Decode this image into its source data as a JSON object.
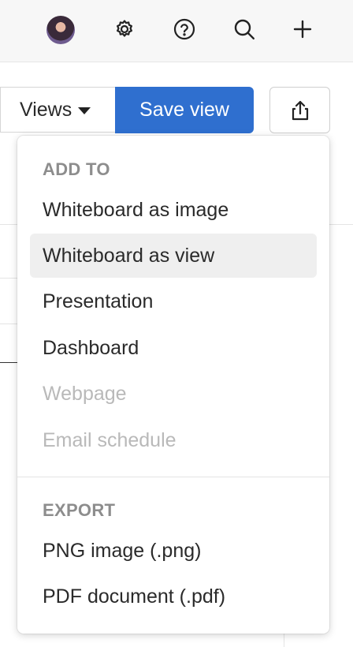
{
  "topbar": {
    "icons": [
      "gear-icon",
      "help-icon",
      "search-icon",
      "plus-icon"
    ]
  },
  "toolbar": {
    "views_label": "Views",
    "save_label": "Save view"
  },
  "menu": {
    "add_to_header": "ADD TO",
    "add_to_items": [
      {
        "label": "Whiteboard as image",
        "state": "enabled"
      },
      {
        "label": "Whiteboard as view",
        "state": "hovered"
      },
      {
        "label": "Presentation",
        "state": "enabled"
      },
      {
        "label": "Dashboard",
        "state": "enabled"
      },
      {
        "label": "Webpage",
        "state": "disabled"
      },
      {
        "label": "Email schedule",
        "state": "disabled"
      }
    ],
    "export_header": "EXPORT",
    "export_items": [
      {
        "label": "PNG image (.png)",
        "state": "enabled"
      },
      {
        "label": "PDF document (.pdf)",
        "state": "enabled"
      }
    ]
  },
  "colors": {
    "primary": "#2f6fcf",
    "disabled_text": "#b9b9b9",
    "header_text": "#8d8d8d"
  }
}
